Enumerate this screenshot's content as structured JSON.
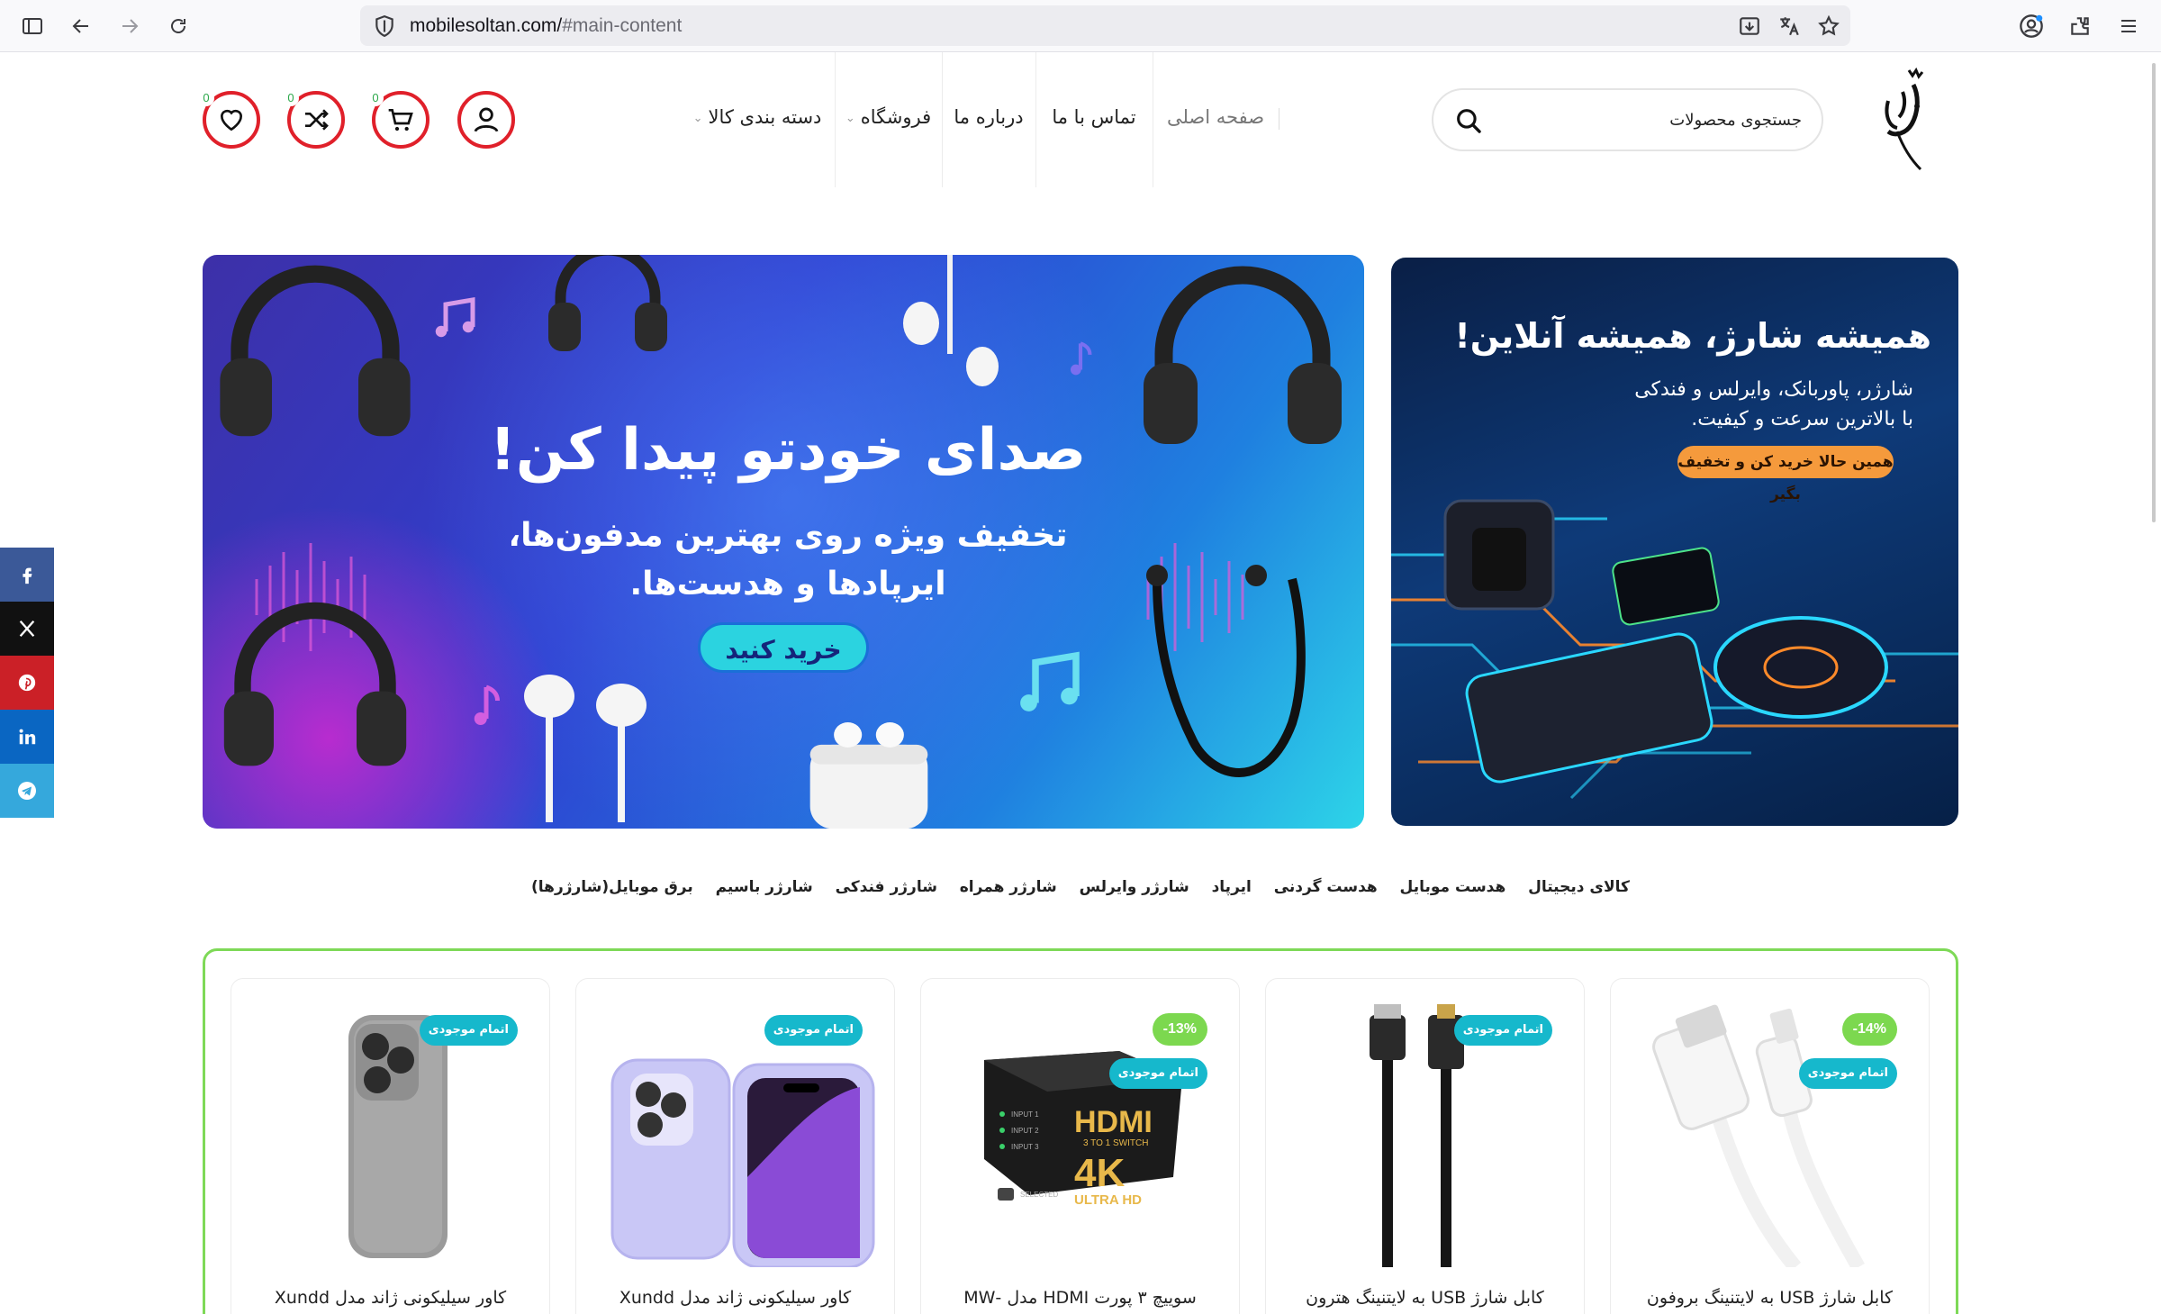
{
  "browser": {
    "url_domain": "mobilesoltan.com/",
    "url_path": "#main-content"
  },
  "header": {
    "search_placeholder": "جستجوی محصولات",
    "nav": [
      {
        "label": "صفحه اصلی"
      },
      {
        "label": "تماس با ما"
      },
      {
        "label": "درباره ما"
      },
      {
        "label": "فروشگاه"
      },
      {
        "label": "دسته بندی کالا"
      }
    ],
    "cart_count": "0",
    "compare_count": "0",
    "wishlist_count": "0",
    "accent_color": "#e0202a"
  },
  "social": [
    {
      "icon": "facebook-icon",
      "color": "#3b5998"
    },
    {
      "icon": "x-icon",
      "color": "#111111"
    },
    {
      "icon": "pinterest-icon",
      "color": "#cb2027"
    },
    {
      "icon": "linkedin-icon",
      "color": "#0a66c2"
    },
    {
      "icon": "telegram-icon",
      "color": "#35a8dc"
    }
  ],
  "banner_main": {
    "title": "صدای خودتو پیدا کن!",
    "subtitle_line1": "تخفیف ویژه روی بهترین مدفون‌ها،",
    "subtitle_line2": "ایرپادها و هدست‌ها.",
    "button": "خرید کنید"
  },
  "banner_side": {
    "title": "همیشه شارژ، همیشه آنلاین!",
    "subtitle_line1": "شارژر، پاوربانک، وایرلس و فندکی",
    "subtitle_line2": "با بالاترین سرعت و کیفیت.",
    "button": "همین حالا خرید کن و تخفیف بگیر"
  },
  "categories": [
    "کالای دیجیتال",
    "هدست موبایل",
    "هدست گردنی",
    "ایرپاد",
    "شارژر وایرلس",
    "شارژر همراه",
    "شارژر فندکی",
    "شارژر باسیم",
    "برق موبایل(شارژرها)"
  ],
  "products": [
    {
      "name": "کابل شارژ USB به لایتنینگ بروفون",
      "discount": "-14%",
      "status": "اتمام موجودی",
      "image": "white-cable"
    },
    {
      "name": "کابل شارژ USB به لایتنینگ هترون",
      "discount": "",
      "status": "اتمام موجودی",
      "image": "black-cable"
    },
    {
      "name": "سوییچ ۳ پورت HDMI مدل -MW",
      "discount": "-13%",
      "status": "اتمام موجودی",
      "image": "hdmi-switch",
      "box_brand": "HDMI",
      "box_sub": "3 TO 1 SWITCH",
      "box_res": "4K",
      "box_res_sub": "ULTRA HD",
      "box_inputs": [
        "INPUT 1",
        "INPUT 2",
        "INPUT 3"
      ],
      "box_selected": "SELECTED"
    },
    {
      "name": "کاور سیلیکونی ژاند مدل Xundd",
      "discount": "",
      "status": "اتمام موجودی",
      "image": "purple-case"
    },
    {
      "name": "کاور سیلیکونی ژاند مدل Xundd",
      "discount": "",
      "status": "اتمام موجودی",
      "image": "gray-case"
    }
  ]
}
